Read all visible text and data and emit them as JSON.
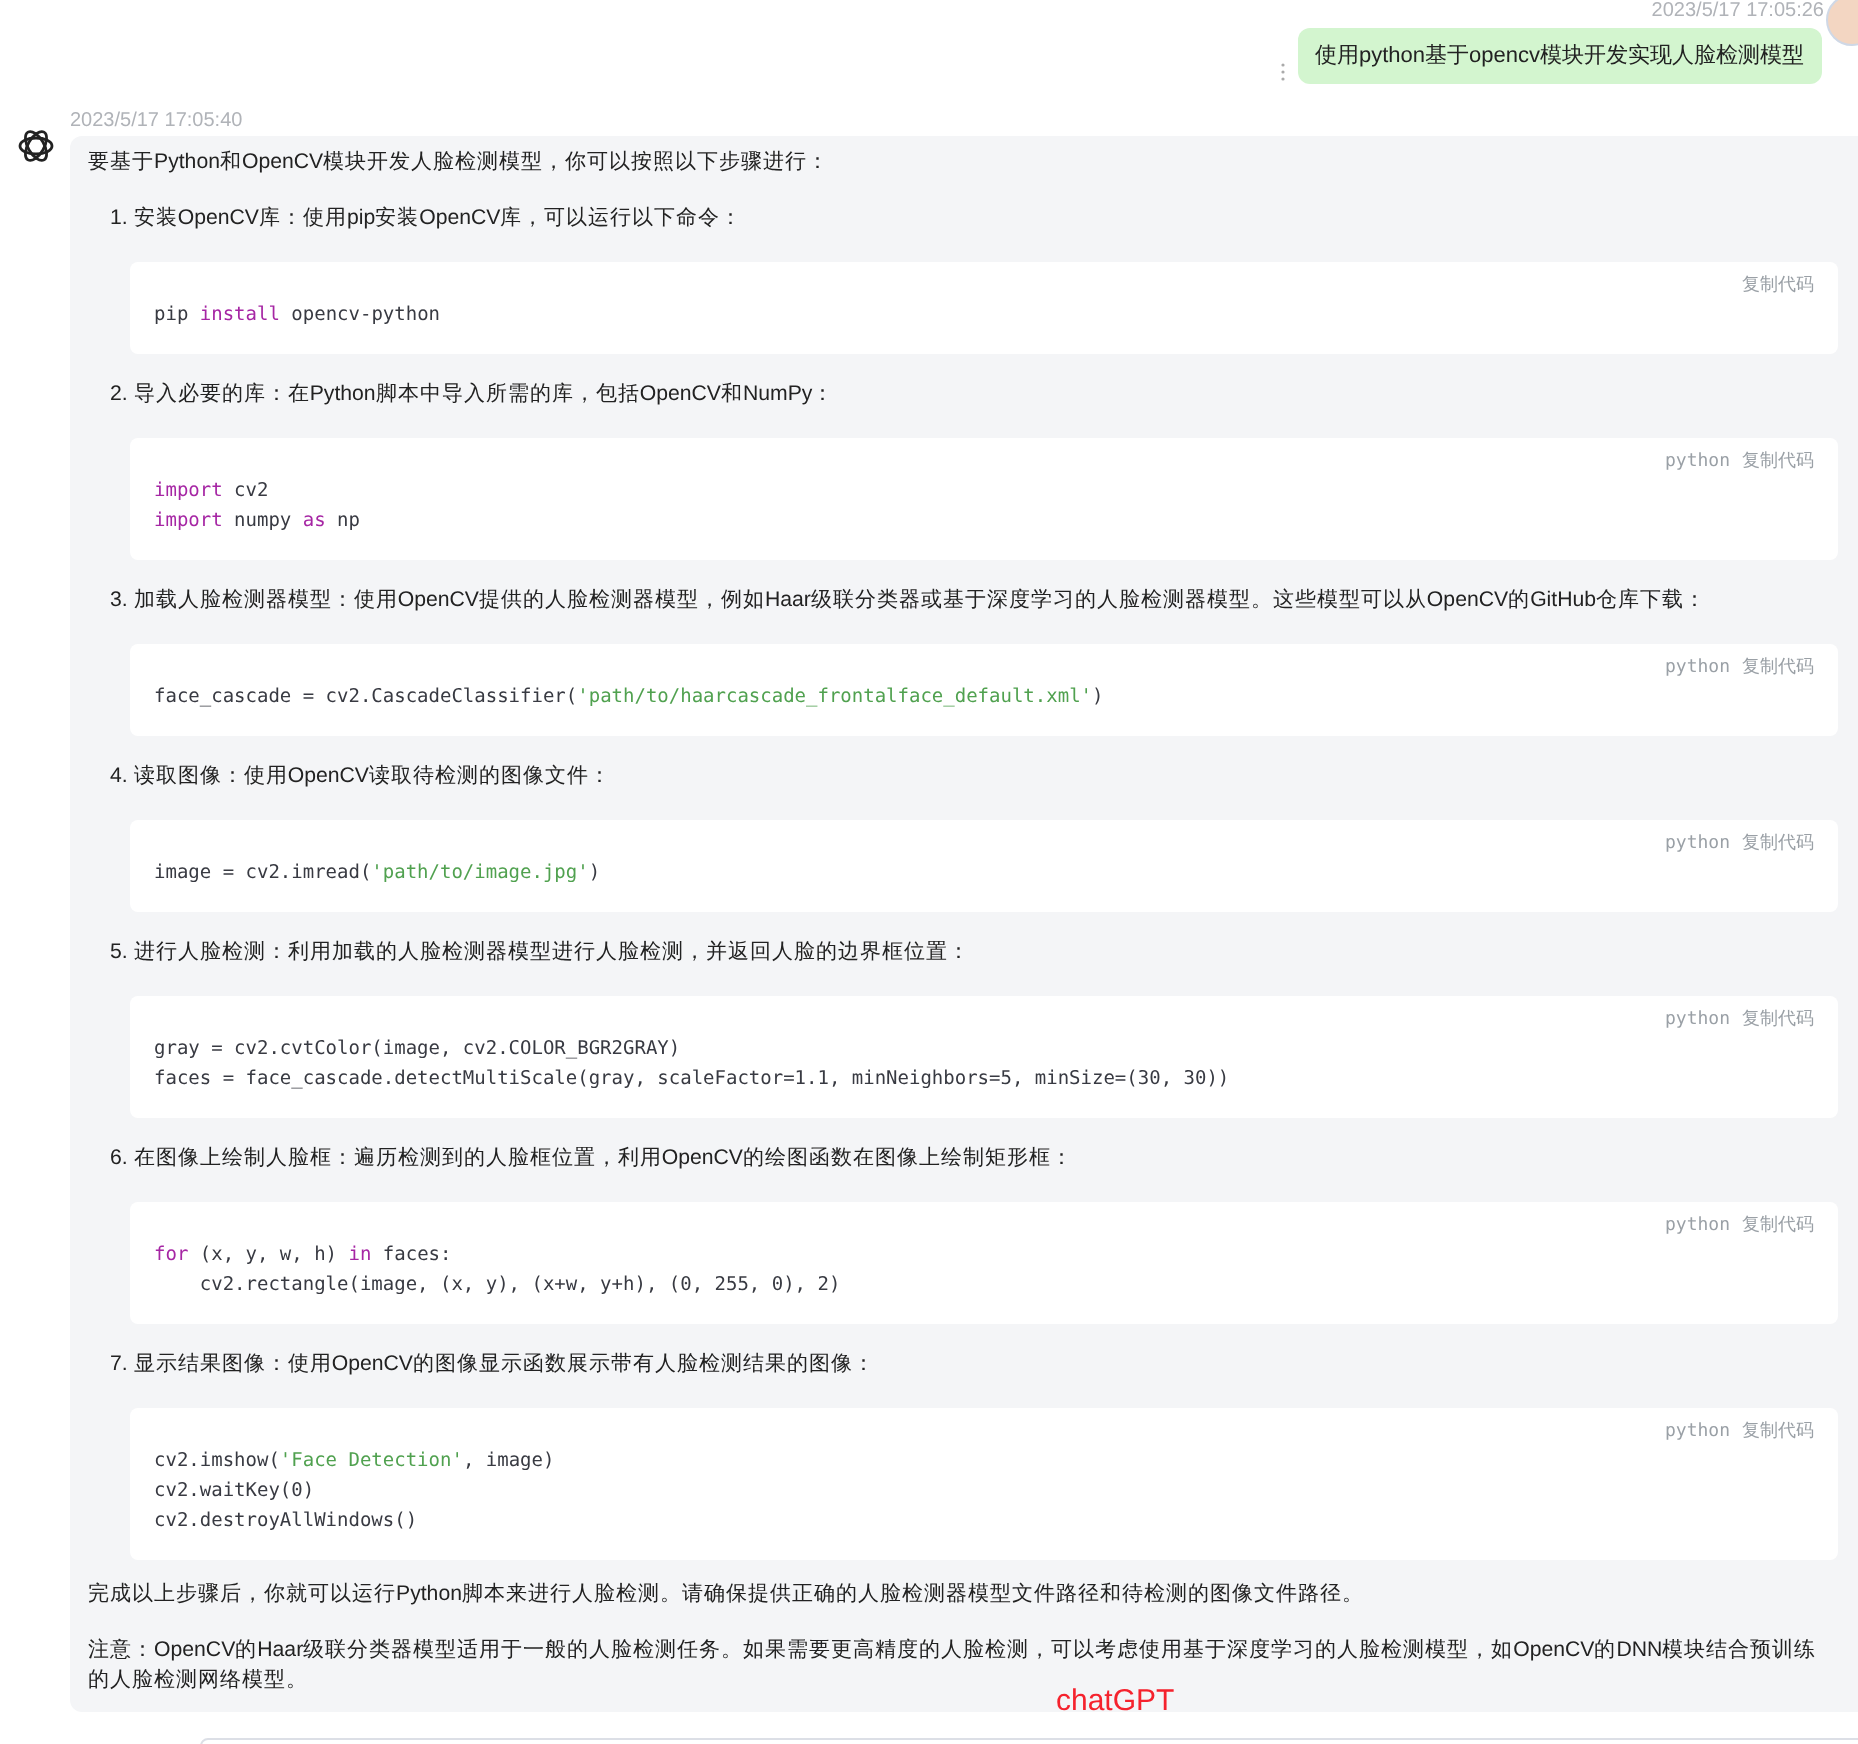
{
  "user_message": {
    "time": "2023/5/17 17:05:26",
    "text": "使用python基于opencv模块开发实现人脸检测模型"
  },
  "reply": {
    "time": "2023/5/17 17:05:40",
    "intro": "要基于Python和OpenCV模块开发人脸检测模型，你可以按照以下步骤进行：",
    "steps": [
      {
        "number": "1.",
        "text": "安装OpenCV库：使用pip安装OpenCV库，可以运行以下命令：",
        "code": {
          "copy": "复制代码",
          "lines": [
            [
              {
                "kind": "plain",
                "text": "pip "
              },
              {
                "kind": "keyword",
                "text": "install"
              },
              {
                "kind": "plain",
                "text": " opencv-python"
              }
            ]
          ]
        }
      },
      {
        "number": "2.",
        "text": "导入必要的库：在Python脚本中导入所需的库，包括OpenCV和NumPy：",
        "code": {
          "language": "python",
          "copy": "复制代码",
          "lines": [
            [
              {
                "kind": "keyword",
                "text": "import"
              },
              {
                "kind": "plain",
                "text": " cv2"
              }
            ],
            [
              {
                "kind": "keyword",
                "text": "import"
              },
              {
                "kind": "plain",
                "text": " numpy "
              },
              {
                "kind": "keyword",
                "text": "as"
              },
              {
                "kind": "plain",
                "text": " np"
              }
            ]
          ]
        }
      },
      {
        "number": "3.",
        "text": "加载人脸检测器模型：使用OpenCV提供的人脸检测器模型，例如Haar级联分类器或基于深度学习的人脸检测器模型。这些模型可以从OpenCV的GitHub仓库下载：",
        "code": {
          "language": "python",
          "copy": "复制代码",
          "lines": [
            [
              {
                "kind": "plain",
                "text": "face_cascade = cv2.CascadeClassifier("
              },
              {
                "kind": "string",
                "text": "'path/to/haarcascade_frontalface_default.xml'"
              },
              {
                "kind": "plain",
                "text": ")"
              }
            ]
          ]
        }
      },
      {
        "number": "4.",
        "text": "读取图像：使用OpenCV读取待检测的图像文件：",
        "code": {
          "language": "python",
          "copy": "复制代码",
          "lines": [
            [
              {
                "kind": "plain",
                "text": "image = cv2.imread("
              },
              {
                "kind": "string",
                "text": "'path/to/image.jpg'"
              },
              {
                "kind": "plain",
                "text": ")"
              }
            ]
          ]
        }
      },
      {
        "number": "5.",
        "text": "进行人脸检测：利用加载的人脸检测器模型进行人脸检测，并返回人脸的边界框位置：",
        "code": {
          "language": "python",
          "copy": "复制代码",
          "lines": [
            [
              {
                "kind": "plain",
                "text": "gray = cv2.cvtColor(image, cv2.COLOR_BGR2GRAY)"
              }
            ],
            [
              {
                "kind": "plain",
                "text": "faces = face_cascade.detectMultiScale(gray, scaleFactor=1.1, minNeighbors=5, minSize=(30, 30))"
              }
            ]
          ]
        }
      },
      {
        "number": "6.",
        "text": "在图像上绘制人脸框：遍历检测到的人脸框位置，利用OpenCV的绘图函数在图像上绘制矩形框：",
        "code": {
          "language": "python",
          "copy": "复制代码",
          "lines": [
            [
              {
                "kind": "keyword",
                "text": "for"
              },
              {
                "kind": "plain",
                "text": " (x, y, w, h) "
              },
              {
                "kind": "keyword",
                "text": "in"
              },
              {
                "kind": "plain",
                "text": " faces:"
              }
            ],
            [
              {
                "kind": "plain",
                "text": "    cv2.rectangle(image, (x, y), (x+w, y+h), (0, 255, 0), 2)"
              }
            ]
          ]
        }
      },
      {
        "number": "7.",
        "text": "显示结果图像：使用OpenCV的图像显示函数展示带有人脸检测结果的图像：",
        "code": {
          "language": "python",
          "copy": "复制代码",
          "lines": [
            [
              {
                "kind": "plain",
                "text": "cv2.imshow("
              },
              {
                "kind": "string",
                "text": "'Face Detection'"
              },
              {
                "kind": "plain",
                "text": ", image)"
              }
            ],
            [
              {
                "kind": "plain",
                "text": "cv2.waitKey(0)"
              }
            ],
            [
              {
                "kind": "plain",
                "text": "cv2.destroyAllWindows()"
              }
            ]
          ]
        }
      }
    ],
    "paragraphs": [
      "完成以上步骤后，你就可以运行Python脚本来进行人脸检测。请确保提供正确的人脸检测器模型文件路径和待检测的图像文件路径。",
      "注意：OpenCV的Haar级联分类器模型适用于一般的人脸检测任务。如果需要更高精度的人脸检测，可以考虑使用基于深度学习的人脸检测模型，如OpenCV的DNN模块结合预训练的人脸检测网络模型。"
    ]
  },
  "caption": "chatGPT"
}
